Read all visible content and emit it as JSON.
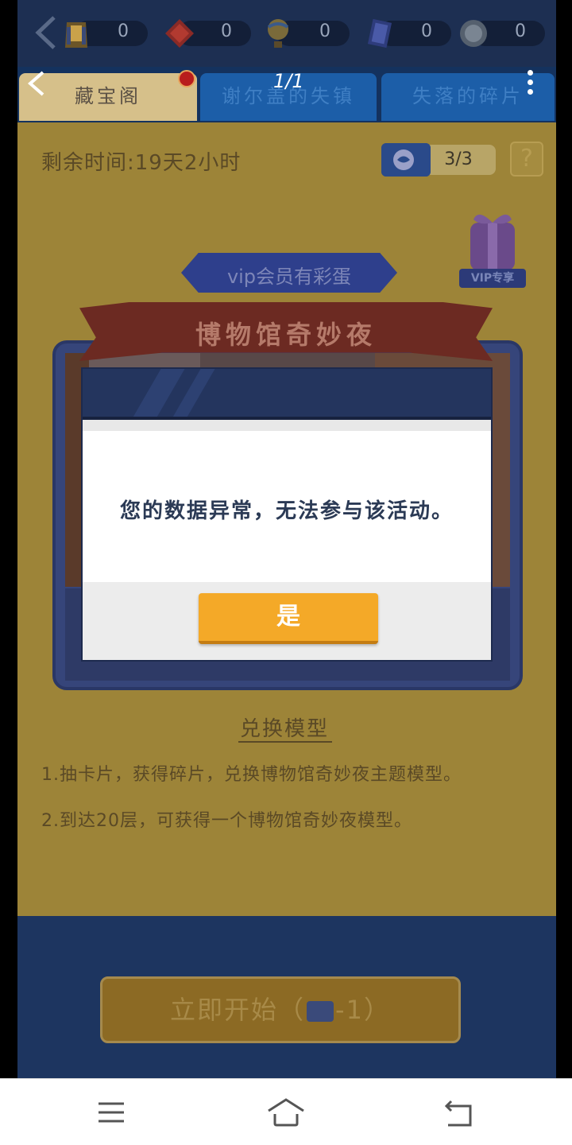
{
  "resources": [
    {
      "icon": "pharaoh-icon",
      "value": "0"
    },
    {
      "icon": "red-gem-icon",
      "value": "0"
    },
    {
      "icon": "balloon-icon",
      "value": "0"
    },
    {
      "icon": "card-icon",
      "value": "0"
    },
    {
      "icon": "silver-coin-icon",
      "value": "0"
    }
  ],
  "header": {
    "page_indicator": "1/1"
  },
  "tabs": [
    {
      "label": "藏宝阁",
      "active": true
    },
    {
      "label": "谢尔盖的失镇",
      "active": false
    },
    {
      "label": "失落的碎片",
      "active": false
    }
  ],
  "panel": {
    "time_left": "剩余时间:19天2小时",
    "ticket_count": "3/3",
    "help": "?",
    "vip_badge": "VIP专享",
    "vip_banner": "vip会员有彩蛋",
    "title": "博物馆奇妙夜",
    "exchange_title": "兑换模型",
    "rules": [
      "1.抽卡片，获得碎片，兑换博物馆奇妙夜主题模型。",
      "2.到达20层，可获得一个博物馆奇妙夜模型。"
    ]
  },
  "bottom": {
    "start_label": "立即开始（",
    "start_cost": "-1）"
  },
  "dialog": {
    "message": "您的数据异常，无法参与该活动。",
    "confirm_label": "是"
  },
  "colors": {
    "dialog_button": "#f4a928",
    "panel_gold": "#9d8438",
    "header_navy": "#1d2f52",
    "tab_blue": "#1c5ea8"
  }
}
